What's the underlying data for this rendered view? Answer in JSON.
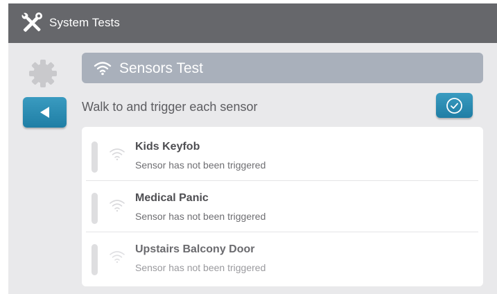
{
  "titlebar": {
    "title": "System Tests",
    "icon": "tools-icon"
  },
  "side": {
    "gear_icon": "gear-icon",
    "back_icon": "back-arrow-icon"
  },
  "header": {
    "icon": "wifi-icon",
    "title": "Sensors Test"
  },
  "instruction": "Walk to and trigger each sensor",
  "confirm_icon": "check-circle-icon",
  "sensors": [
    {
      "name": "Kids Keyfob",
      "status": "Sensor has not been triggered"
    },
    {
      "name": "Medical Panic",
      "status": "Sensor has not been triggered"
    },
    {
      "name": "Upstairs Balcony Door",
      "status": "Sensor has not been triggered"
    }
  ],
  "colors": {
    "titlebar": "#66676b",
    "background": "#e9e9eb",
    "header_bar": "#a9b0bb",
    "accent": "#2a8db5"
  }
}
